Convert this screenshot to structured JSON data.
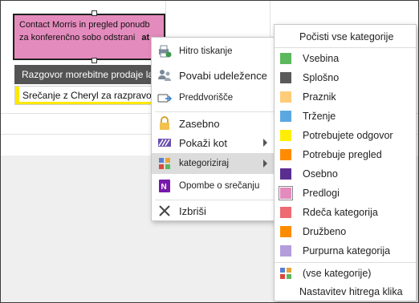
{
  "appointments": {
    "selected": {
      "line1": "Contact Morris in pregled ponudb",
      "line2": "za konferenčno sobo odstrani",
      "line2_tail": "at"
    },
    "dark": "Razgovor morebitne prodaje lahko",
    "yellow": "Srečanje z Cheryl za razpravo o d"
  },
  "context_menu": {
    "items": [
      {
        "label": "Hitro tiskanje",
        "icon": "quick-print-icon"
      },
      {
        "label": "Povabi udeležence",
        "icon": "invite-attendees-icon"
      },
      {
        "label": "Preddvorišče",
        "icon": "lobby-icon"
      },
      {
        "label": "Zasebno",
        "icon": "lock-icon"
      },
      {
        "label": "Pokaži kot",
        "icon": "show-as-icon"
      },
      {
        "label": "kategoriziraj",
        "icon": "categorize-icon"
      },
      {
        "label": "Opombe o srečanju",
        "icon": "onenote-icon"
      },
      {
        "label": "Izbriši",
        "icon": "delete-icon"
      }
    ]
  },
  "category_menu": {
    "clear_all": "Počisti vse kategorije",
    "categories": [
      {
        "label": "Vsebina",
        "color": "#5cb85c"
      },
      {
        "label": "Splošno",
        "color": "#5a5a5a"
      },
      {
        "label": "Praznik",
        "color": "#ffcc7a"
      },
      {
        "label": "Trženje",
        "color": "#5ba8e0"
      },
      {
        "label": "Potrebujete odgovor",
        "color": "#ffee00"
      },
      {
        "label": "Potrebuje pregled",
        "color": "#ff8c00"
      },
      {
        "label": "Osebno",
        "color": "#5c2d91"
      },
      {
        "label": "Predlogi",
        "color": "#e48bbd"
      },
      {
        "label": "Rdeča kategorija",
        "color": "#ee6b73"
      },
      {
        "label": "Družbeno",
        "color": "#ff8c00"
      },
      {
        "label": "Purpurna kategorija",
        "color": "#b39ddb"
      }
    ],
    "all_categories": "(vse kategorije)",
    "quick_click": "Nastavitev hitrega klika"
  }
}
